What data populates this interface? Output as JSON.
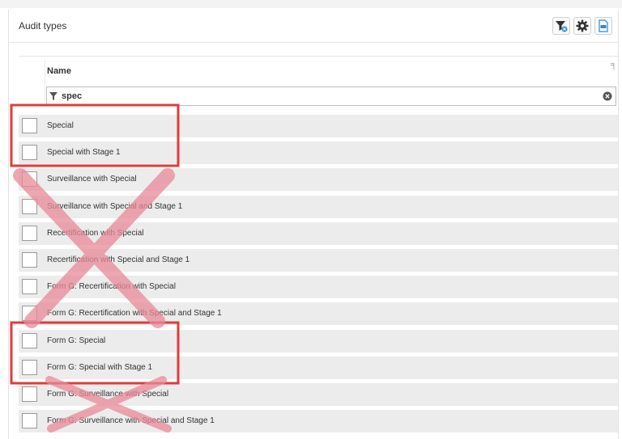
{
  "panel": {
    "title": "Audit types",
    "icons": [
      "filter-clear-icon",
      "gear-icon",
      "export-icon"
    ]
  },
  "grid": {
    "column_header": "Name",
    "filter": {
      "value": "spec"
    },
    "rows": [
      {
        "label": "Special",
        "checked": false
      },
      {
        "label": "Special with Stage 1",
        "checked": false
      },
      {
        "label": "Surveillance with Special",
        "checked": false
      },
      {
        "label": "Surveillance with Special and Stage 1",
        "checked": false
      },
      {
        "label": "Recertification with Special",
        "checked": false
      },
      {
        "label": "Recertification with Special and Stage 1",
        "checked": false
      },
      {
        "label": "Form G: Recertification with Special",
        "checked": false
      },
      {
        "label": "Form G: Recertification with Special and Stage 1",
        "checked": false
      },
      {
        "label": "Form G: Special",
        "checked": false
      },
      {
        "label": "Form G: Special with Stage 1",
        "checked": false
      },
      {
        "label": "Form G: Surveillance with Special",
        "checked": false
      },
      {
        "label": "Form G: Surveillance with Special and Stage 1",
        "checked": false
      }
    ]
  },
  "annotations": {
    "box_color": "#e03c3c",
    "cross_color": "#e88a98",
    "highlighted_rows": [
      "Special",
      "Special with Stage 1",
      "Form G: Special",
      "Form G: Special with Stage 1"
    ]
  }
}
